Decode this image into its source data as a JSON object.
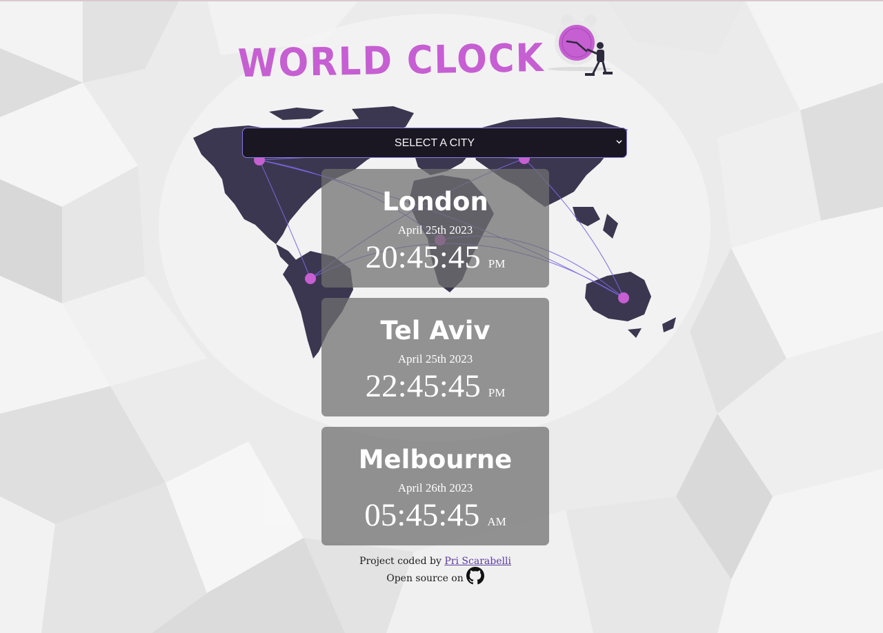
{
  "header": {
    "title": "WORLD CLOCK"
  },
  "city_select": {
    "selected": "SELECT A CITY"
  },
  "cities": [
    {
      "name": "London",
      "date": "April 25th 2023",
      "time": "20:45:45",
      "ampm": "PM"
    },
    {
      "name": "Tel Aviv",
      "date": "April 25th 2023",
      "time": "22:45:45",
      "ampm": "PM"
    },
    {
      "name": "Melbourne",
      "date": "April 26th 2023",
      "time": "05:45:45",
      "ampm": "AM"
    }
  ],
  "footer": {
    "credit_prefix": "Project coded by",
    "author": "Pri Scarabelli",
    "open_source_text": "Open source on",
    "github_icon": "github-icon"
  },
  "colors": {
    "accent": "#c65fd2",
    "map": "#3c3750",
    "select_bg": "#1a1722",
    "select_border": "#8c7ae6",
    "card_bg": "#707070",
    "connection_line": "#7a68e0"
  }
}
